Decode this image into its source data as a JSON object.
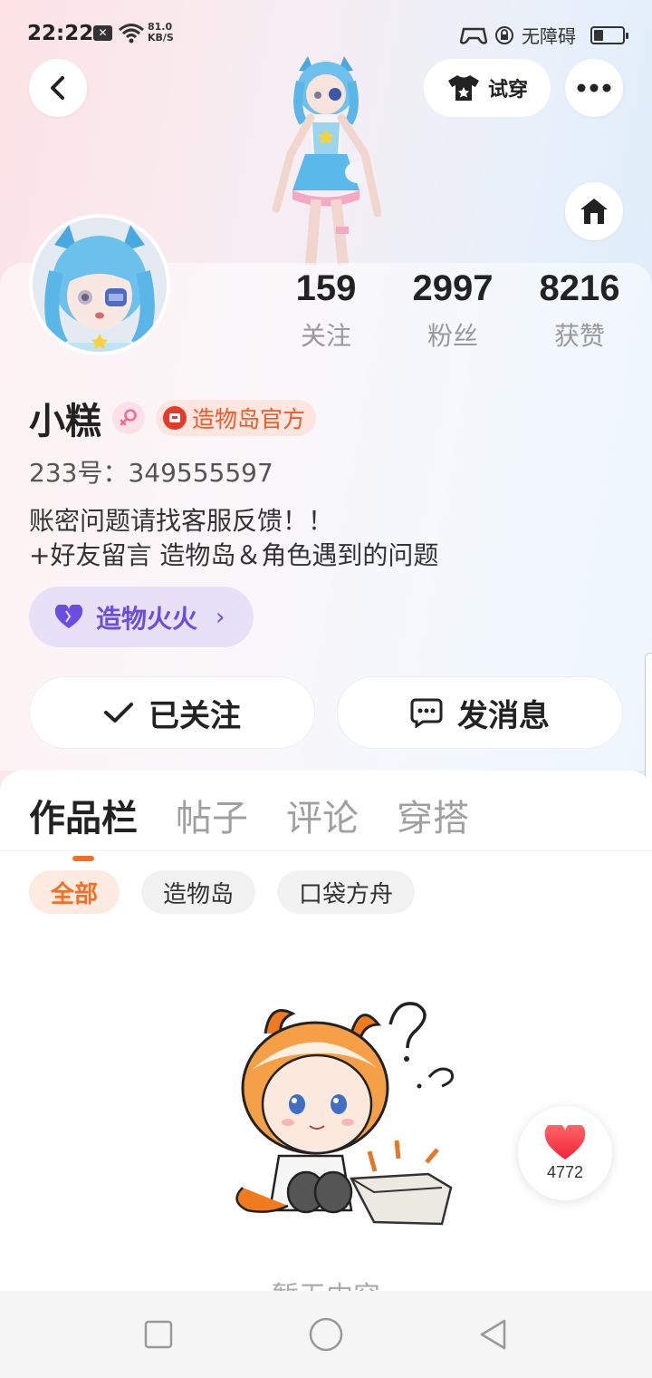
{
  "status_bar": {
    "time": "22:22",
    "notif": "✕",
    "speed_value": "81.0",
    "speed_unit": "KB/S",
    "accessibility": "无障碍"
  },
  "header": {
    "try_on_label": "试穿"
  },
  "profile": {
    "name": "小糕",
    "official_badge": "造物岛官方",
    "uid": "233号：349555597",
    "bio_line1": "账密问题请找客服反馈！！",
    "bio_line2": "+好友留言 造物岛＆角色遇到的问题",
    "tag": "造物火火",
    "stats": [
      {
        "value": "159",
        "label": "关注"
      },
      {
        "value": "2997",
        "label": "粉丝"
      },
      {
        "value": "8216",
        "label": "获赞"
      }
    ]
  },
  "actions": {
    "follow_label": "已关注",
    "message_label": "发消息"
  },
  "tabs": [
    "作品栏",
    "帖子",
    "评论",
    "穿搭"
  ],
  "filters": [
    "全部",
    "造物岛",
    "口袋方舟"
  ],
  "empty_text": "暂无内容",
  "like_count": "4772",
  "colors": {
    "accent": "#f36f27",
    "tag_purple": "#6a4ee0",
    "like_red": "#f23a4a"
  }
}
